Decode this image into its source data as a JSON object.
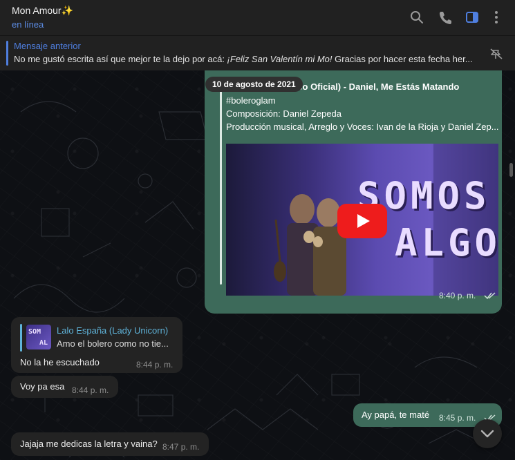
{
  "header": {
    "title": "Mon Amour✨",
    "status": "en línea",
    "icons": [
      "search-icon",
      "phone-icon",
      "sidebar-toggle-icon",
      "more-vertical-icon"
    ]
  },
  "pinned": {
    "title": "Mensaje anterior",
    "text_prefix": "No me gustó escrita así que mejor te la dejo por acá: ",
    "text_italic": "¡Feliz San Valentín mi Mo!",
    "text_suffix": " Gracias por hacer esta fecha her..."
  },
  "date_pill": "10 de agosto de 2021",
  "video_message": {
    "title": "Somos Algo (Video Oficial) - Daniel, Me Estás Matando",
    "line1": "#boleroglam",
    "line2": "Composición: Daniel Zepeda",
    "line3": "Producción musical, Arreglo y Voces: Ivan de la Rioja y Daniel Zep...",
    "thumb_word1": "SOMOS",
    "thumb_word2": "ALGO",
    "time": "8:40 p. m."
  },
  "messages": [
    {
      "reply_name": "Lalo España (Lady Unicorn)",
      "reply_text": "Amo el bolero como no tie...",
      "reply_thumb_top": "SOM",
      "reply_thumb_bottom": "AL",
      "text": "No la he escuchado",
      "time": "8:44 p. m."
    },
    {
      "text": "Voy pa esa",
      "time": "8:44 p. m."
    },
    {
      "text": "Ay papá, te maté",
      "time": "8:45 p. m."
    },
    {
      "text": "Jajaja me dedicas la letra y vaina?",
      "time": "8:47 p. m."
    }
  ],
  "colors": {
    "accent": "#4f7fe0",
    "outgoing_bubble": "#3d6a5a",
    "incoming_bubble": "#232323",
    "reply_accent": "#5fb3d9",
    "youtube_red": "#ee1c1c"
  }
}
